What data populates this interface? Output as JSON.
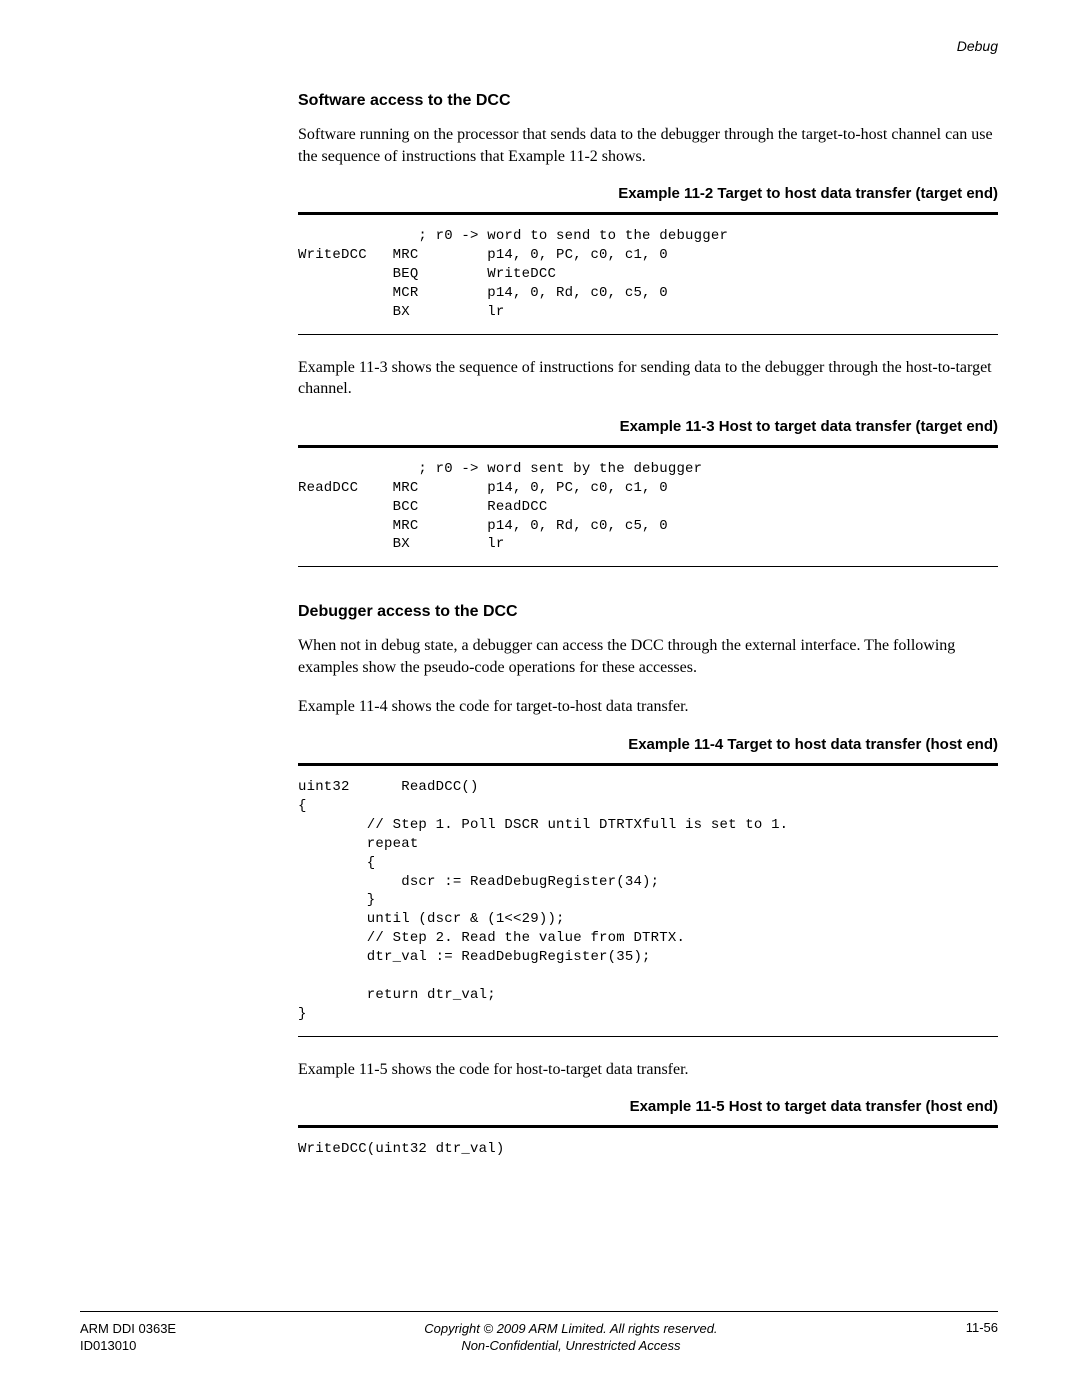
{
  "header": {
    "label": "Debug"
  },
  "sections": {
    "software": {
      "heading": "Software access to the DCC",
      "para": "Software running on the processor that sends data to the debugger through the target-to-host channel can use the sequence of instructions that Example 11-2 shows."
    },
    "ex11_2": {
      "caption": "Example 11-2 Target to host data transfer (target end)",
      "code": "              ; r0 -> word to send to the debugger\nWriteDCC   MRC        p14, 0, PC, c0, c1, 0\n           BEQ        WriteDCC\n           MCR        p14, 0, Rd, c0, c5, 0\n           BX         lr"
    },
    "after_11_2": {
      "para": "Example 11-3 shows the sequence of instructions for sending data to the debugger through the host-to-target channel."
    },
    "ex11_3": {
      "caption": "Example 11-3 Host to target data transfer (target end)",
      "code": "              ; r0 -> word sent by the debugger\nReadDCC    MRC        p14, 0, PC, c0, c1, 0\n           BCC        ReadDCC\n           MRC        p14, 0, Rd, c0, c5, 0\n           BX         lr"
    },
    "debugger": {
      "heading": "Debugger access to the DCC",
      "para1": "When not in debug state, a debugger can access the DCC through the external interface. The following examples show the pseudo-code operations for these accesses.",
      "para2": "Example 11-4 shows the code for target-to-host data transfer."
    },
    "ex11_4": {
      "caption": "Example 11-4 Target to host data transfer (host end)",
      "code": "uint32      ReadDCC()\n{\n        // Step 1. Poll DSCR until DTRTXfull is set to 1.\n        repeat\n        {\n            dscr := ReadDebugRegister(34);\n        }\n        until (dscr & (1<<29));\n        // Step 2. Read the value from DTRTX.\n        dtr_val := ReadDebugRegister(35);\n\n        return dtr_val;\n}"
    },
    "after_11_4": {
      "para": "Example 11-5 shows the code for host-to-target data transfer."
    },
    "ex11_5": {
      "caption": "Example 11-5 Host to target data transfer (host end)",
      "code": "WriteDCC(uint32 dtr_val)"
    }
  },
  "footer": {
    "left1": "ARM DDI 0363E",
    "left2": "ID013010",
    "center1": "Copyright © 2009 ARM Limited. All rights reserved.",
    "center2": "Non-Confidential, Unrestricted Access",
    "right": "11-56"
  }
}
